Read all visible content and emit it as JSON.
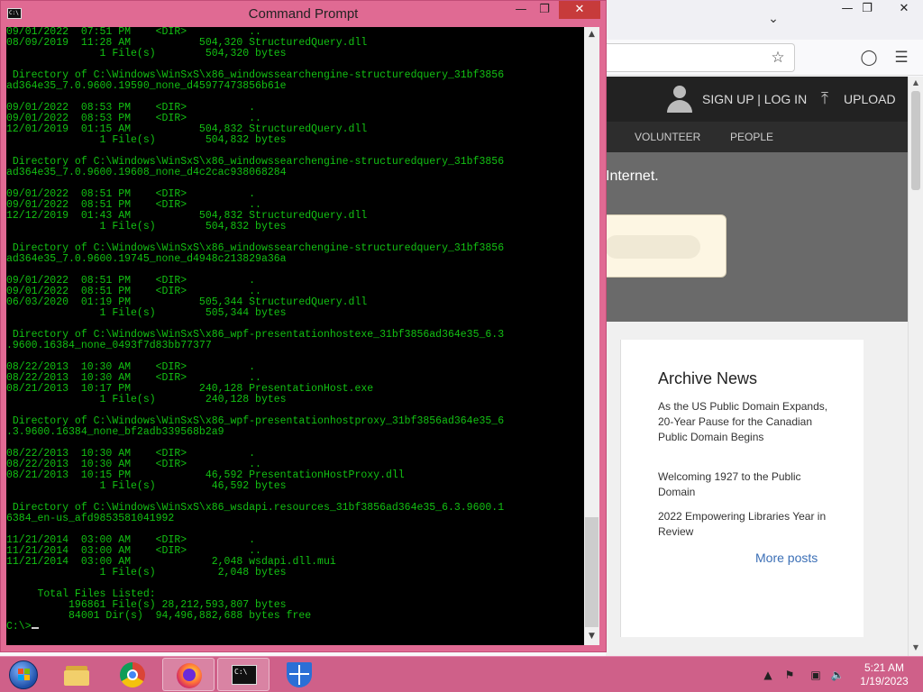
{
  "browser": {
    "toolbar_icons": [
      "star-icon",
      "pocket-icon",
      "menu-icon"
    ],
    "site": {
      "header": {
        "signup_login": "SIGN UP | LOG IN",
        "upload": "UPLOAD"
      },
      "nav": [
        "VOLUNTEER",
        "PEOPLE"
      ],
      "hero_text": "Internet.",
      "archive_news": {
        "title": "Archive News",
        "items": [
          "As the US Public Domain Expands, 20-Year Pause for the Canadian Public Domain Begins",
          "Welcoming 1927 to the Public Domain",
          "2022 Empowering Libraries Year in Review"
        ],
        "more": "More posts"
      }
    }
  },
  "cmd": {
    "title": "Command Prompt",
    "app_icon_text": "C:\\",
    "prompt": "C:\\>",
    "lines": [
      "09/01/2022  07:51 PM    <DIR>          ..",
      "08/09/2019  11:28 AM           504,320 StructuredQuery.dll",
      "               1 File(s)        504,320 bytes",
      "",
      " Directory of C:\\Windows\\WinSxS\\x86_windowssearchengine-structuredquery_31bf3856",
      "ad364e35_7.0.9600.19590_none_d45977473856b61e",
      "",
      "09/01/2022  08:53 PM    <DIR>          .",
      "09/01/2022  08:53 PM    <DIR>          ..",
      "12/01/2019  01:15 AM           504,832 StructuredQuery.dll",
      "               1 File(s)        504,832 bytes",
      "",
      " Directory of C:\\Windows\\WinSxS\\x86_windowssearchengine-structuredquery_31bf3856",
      "ad364e35_7.0.9600.19608_none_d4c2cac938068284",
      "",
      "09/01/2022  08:51 PM    <DIR>          .",
      "09/01/2022  08:51 PM    <DIR>          ..",
      "12/12/2019  01:43 AM           504,832 StructuredQuery.dll",
      "               1 File(s)        504,832 bytes",
      "",
      " Directory of C:\\Windows\\WinSxS\\x86_windowssearchengine-structuredquery_31bf3856",
      "ad364e35_7.0.9600.19745_none_d4948c213829a36a",
      "",
      "09/01/2022  08:51 PM    <DIR>          .",
      "09/01/2022  08:51 PM    <DIR>          ..",
      "06/03/2020  01:19 PM           505,344 StructuredQuery.dll",
      "               1 File(s)        505,344 bytes",
      "",
      " Directory of C:\\Windows\\WinSxS\\x86_wpf-presentationhostexe_31bf3856ad364e35_6.3",
      ".9600.16384_none_0493f7d83bb77377",
      "",
      "08/22/2013  10:30 AM    <DIR>          .",
      "08/22/2013  10:30 AM    <DIR>          ..",
      "08/21/2013  10:17 PM           240,128 PresentationHost.exe",
      "               1 File(s)        240,128 bytes",
      "",
      " Directory of C:\\Windows\\WinSxS\\x86_wpf-presentationhostproxy_31bf3856ad364e35_6",
      ".3.9600.16384_none_bf2adb339568b2a9",
      "",
      "08/22/2013  10:30 AM    <DIR>          .",
      "08/22/2013  10:30 AM    <DIR>          ..",
      "08/21/2013  10:15 PM            46,592 PresentationHostProxy.dll",
      "               1 File(s)         46,592 bytes",
      "",
      " Directory of C:\\Windows\\WinSxS\\x86_wsdapi.resources_31bf3856ad364e35_6.3.9600.1",
      "6384_en-us_afd9853581041992",
      "",
      "11/21/2014  03:00 AM    <DIR>          .",
      "11/21/2014  03:00 AM    <DIR>          ..",
      "11/21/2014  03:00 AM             2,048 wsdapi.dll.mui",
      "               1 File(s)          2,048 bytes",
      "",
      "     Total Files Listed:",
      "          196861 File(s) 28,212,593,807 bytes",
      "          84001 Dir(s)  94,496,882,688 bytes free",
      ""
    ]
  },
  "taskbar": {
    "apps": [
      "file-explorer",
      "chrome",
      "firefox",
      "command-prompt",
      "windows-defender"
    ],
    "clock": {
      "time": "5:21 AM",
      "date": "1/19/2023"
    }
  }
}
